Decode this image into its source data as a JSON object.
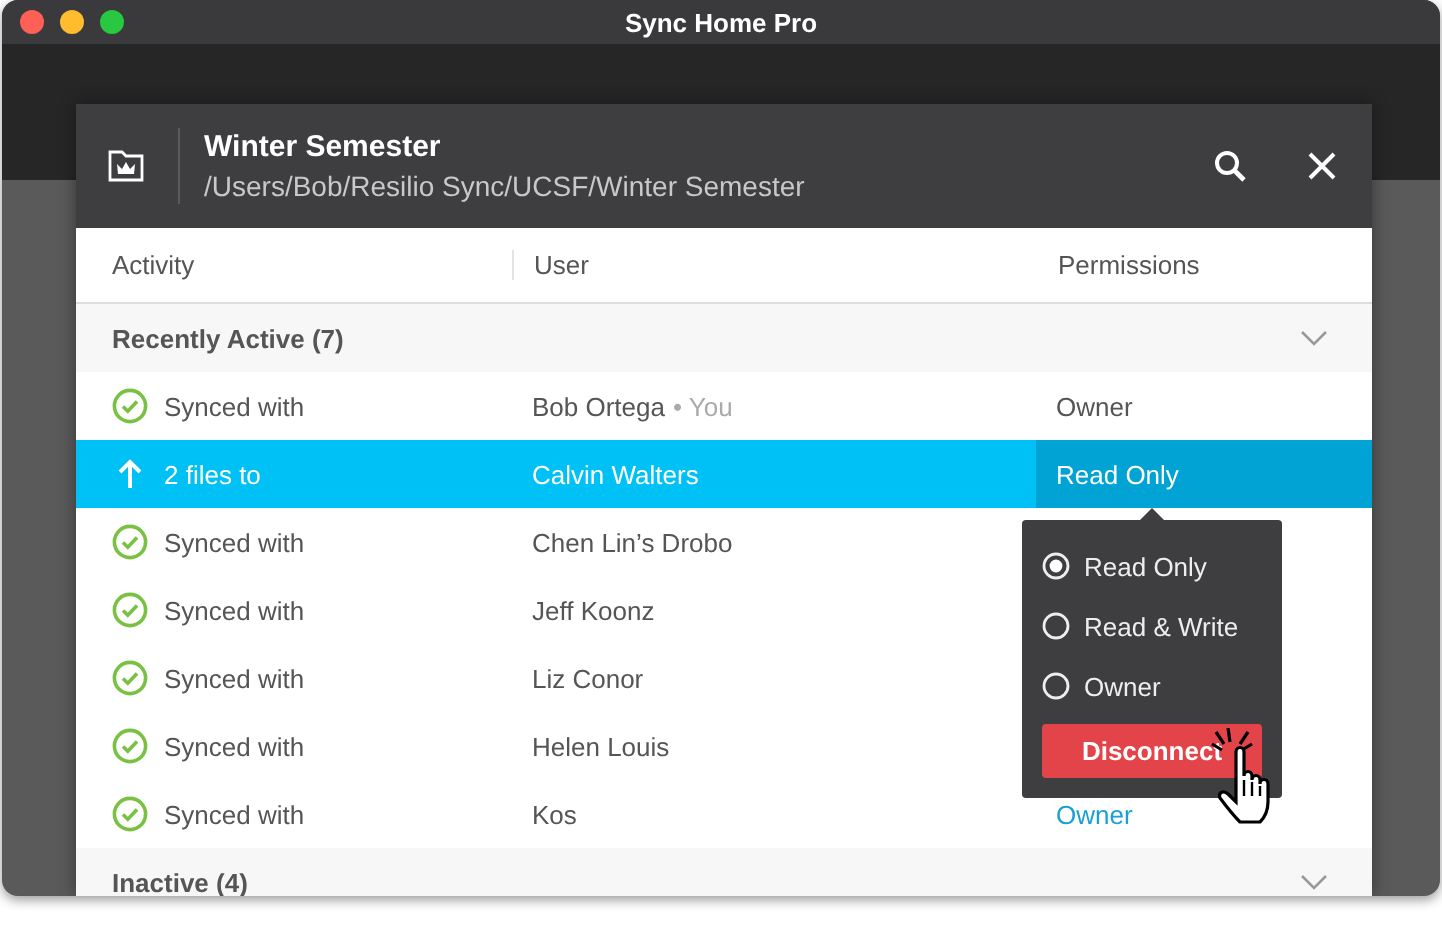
{
  "window": {
    "title": "Sync Home Pro"
  },
  "dialog": {
    "title": "Winter Semester",
    "path": "/Users/Bob/Resilio Sync/UCSF/Winter Semester"
  },
  "columns": [
    "Activity",
    "User",
    "Permissions"
  ],
  "groups": [
    {
      "label": "Recently Active (7)",
      "rows": [
        {
          "kind": "synced",
          "activity": "Synced with",
          "user": "Bob Ortega",
          "note": "• You",
          "permission": "Owner",
          "selected": false,
          "hover": false
        },
        {
          "kind": "upload",
          "activity": "2 files to",
          "user": "Calvin Walters",
          "permission": "Read Only",
          "selected": true,
          "hover": false
        },
        {
          "kind": "synced",
          "activity": "Synced with",
          "user": "Chen Lin’s Drobo",
          "selected": false
        },
        {
          "kind": "synced",
          "activity": "Synced with",
          "user": "Jeff Koonz",
          "selected": false
        },
        {
          "kind": "synced",
          "activity": "Synced with",
          "user": "Liz Conor",
          "selected": false
        },
        {
          "kind": "synced",
          "activity": "Synced with",
          "user": "Helen Louis",
          "selected": false
        },
        {
          "kind": "synced",
          "activity": "Synced with",
          "user": "Kos",
          "permission": "Owner",
          "selected": false,
          "hover": true
        }
      ]
    },
    {
      "label": "Inactive (4)"
    }
  ],
  "popup": {
    "options": [
      {
        "label": "Read Only",
        "selected": true
      },
      {
        "label": "Read & Write",
        "selected": false
      },
      {
        "label": "Owner",
        "selected": false
      }
    ],
    "action": "Disconnect"
  }
}
